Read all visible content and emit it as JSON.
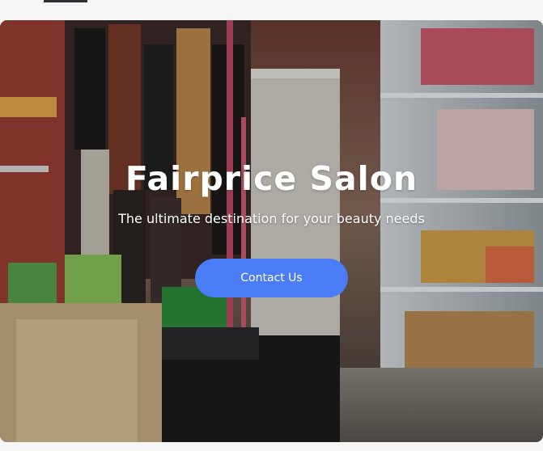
{
  "hero": {
    "title": "Fairprice Salon",
    "subtitle": "The ultimate destination for your beauty needs",
    "cta_label": "Contact Us"
  },
  "colors": {
    "accent": "#4a7cf6",
    "background": "#f6f6f7",
    "text_on_image": "#ffffff"
  }
}
